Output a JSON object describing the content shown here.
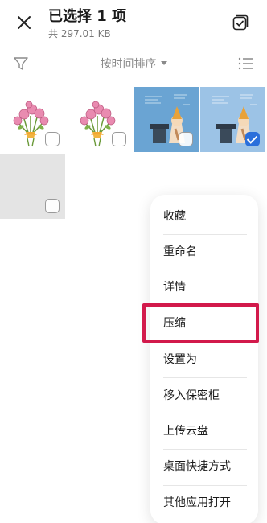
{
  "header": {
    "title": "已选择 1 项",
    "subtitle": "共 297.01 KB",
    "close_icon": "close-icon",
    "select_all_icon": "select-all-icon"
  },
  "toolbar": {
    "filter_icon": "filter-icon",
    "sort_label": "按时间排序",
    "view_icon": "list-view-icon"
  },
  "grid": {
    "items": [
      {
        "type": "flower-bouquet",
        "selected": false
      },
      {
        "type": "flower-bouquet",
        "selected": false
      },
      {
        "type": "illustration-blue",
        "selected": false
      },
      {
        "type": "illustration-blue",
        "selected": true
      },
      {
        "type": "blank-gray",
        "selected": false
      }
    ]
  },
  "menu": {
    "items": [
      "收藏",
      "重命名",
      "详情",
      "压缩",
      "设置为",
      "移入保密柜",
      "上传云盘",
      "桌面快捷方式",
      "其他应用打开"
    ]
  },
  "colors": {
    "accent": "#2a6fdb",
    "highlight": "#d2194b"
  }
}
